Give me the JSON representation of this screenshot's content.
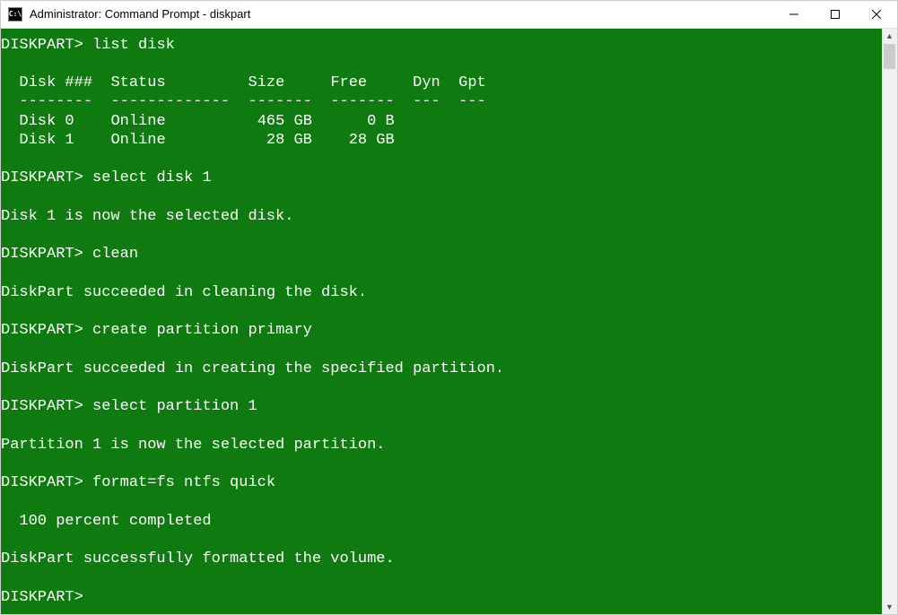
{
  "window": {
    "title": "Administrator: Command Prompt - diskpart",
    "icon_label": "C:\\"
  },
  "prompt": "DISKPART>",
  "commands": {
    "list_disk": "list disk",
    "select_disk": "select disk 1",
    "clean": "clean",
    "create_partition": "create partition primary",
    "select_partition": "select partition 1",
    "format": "format=fs ntfs quick"
  },
  "disk_table": {
    "headers": {
      "disk": "Disk ###",
      "status": "Status",
      "size": "Size",
      "free": "Free",
      "dyn": "Dyn",
      "gpt": "Gpt"
    },
    "rows": [
      {
        "disk": "Disk 0",
        "status": "Online",
        "size": "465 GB",
        "free": "0 B"
      },
      {
        "disk": "Disk 1",
        "status": "Online",
        "size": "28 GB",
        "free": "28 GB"
      }
    ]
  },
  "messages": {
    "disk_selected": "Disk 1 is now the selected disk.",
    "clean_success": "DiskPart succeeded in cleaning the disk.",
    "partition_created": "DiskPart succeeded in creating the specified partition.",
    "partition_selected": "Partition 1 is now the selected partition.",
    "progress": "  100 percent completed",
    "format_success": "DiskPart successfully formatted the volume."
  }
}
